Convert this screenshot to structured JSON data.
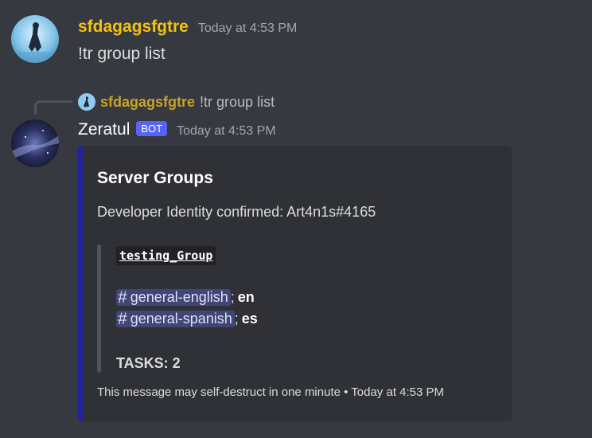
{
  "message1": {
    "username": "sfdagagsfgtre",
    "timestamp": "Today at 4:53 PM",
    "text": "!tr group list"
  },
  "reply": {
    "username": "sfdagagsfgtre",
    "text": "!tr group list"
  },
  "message2": {
    "username": "Zeratul",
    "badge": "BOT",
    "timestamp": "Today at 4:53 PM",
    "embed": {
      "accent_color": "#2323a0",
      "title": "Server Groups",
      "description": "Developer Identity confirmed: Art4n1s#4165",
      "group_name": "testing_Group",
      "channels": [
        {
          "hash": "#",
          "name": "general-english",
          "sep": ";",
          "lang": "en"
        },
        {
          "hash": "#",
          "name": "general-spanish",
          "sep": ";",
          "lang": "es"
        }
      ],
      "tasks": "TASKS: 2",
      "footer": "This message may self-destruct in one minute • Today at 4:53 PM"
    }
  },
  "colors": {
    "background": "#36393f",
    "embed_bg": "#2f3136",
    "username1": "#f1c40f",
    "bot_badge": "#5865f2",
    "mention_bg": "#414675"
  }
}
